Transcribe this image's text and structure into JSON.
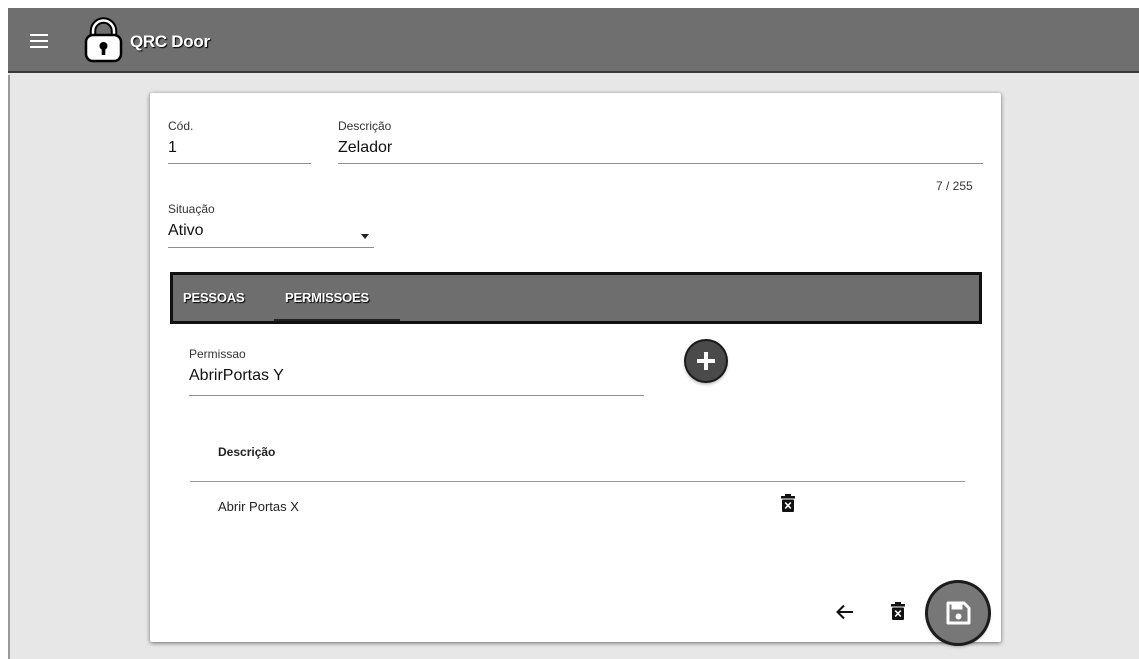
{
  "appbar": {
    "title": "QRC Door",
    "menu_icon": "menu-icon",
    "logo_icon": "padlock-icon"
  },
  "form": {
    "cod": {
      "label": "Cód.",
      "value": "1"
    },
    "descricao": {
      "label": "Descrição",
      "value": "Zelador",
      "counter": "7 / 255"
    },
    "situacao": {
      "label": "Situação",
      "value": "Ativo"
    }
  },
  "tabs": [
    {
      "label": "PESSOAS",
      "active": false
    },
    {
      "label": "PERMISSOES",
      "active": true
    }
  ],
  "permissao": {
    "label": "Permissao",
    "value": "AbrirPortas Y",
    "add_icon": "plus-circle-icon"
  },
  "table": {
    "header": "Descrição",
    "rows": [
      {
        "descricao": "Abrir Portas X",
        "action_icon": "trash-icon"
      }
    ]
  },
  "footer": {
    "back_icon": "arrow-left-icon",
    "delete_icon": "trash-icon",
    "save_icon": "floppy-disk-icon"
  },
  "colors": {
    "appbar": "#6f6f6f",
    "background": "#e7e7e7",
    "card": "#ffffff"
  }
}
